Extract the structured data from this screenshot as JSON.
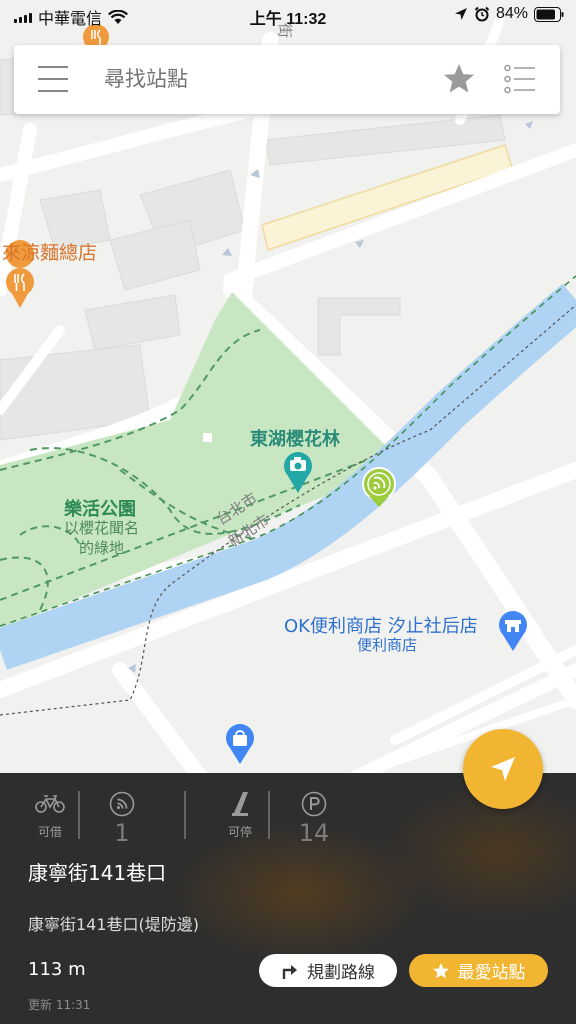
{
  "status_bar": {
    "carrier": "中華電信",
    "time": "上午 11:32",
    "battery": "84%",
    "battery_level": 0.84
  },
  "search": {
    "placeholder": "尋找站點"
  },
  "map": {
    "labels": {
      "restaurant": "來涼麵總店",
      "blossom_forest": "東湖櫻花林",
      "park_name": "樂活公園",
      "park_desc_1": "以櫻花聞名",
      "park_desc_2": "的綠地",
      "taipei": "台北市",
      "new_taipei": "新北市",
      "store_name": "OK便利商店 汐止社后店",
      "store_category": "便利商店",
      "street_partial": "街"
    },
    "colors": {
      "park": "#c9e6c3",
      "river": "#aed3f3",
      "road": "#ffffff",
      "restaurant_pin": "#f09a3e",
      "photo_pin": "#23a7a7",
      "store_pin": "#4285f4",
      "station_pin": "#9ccb3b"
    }
  },
  "station": {
    "rentable_label": "可借",
    "rentable_count": "1",
    "returnable_label": "可停",
    "returnable_count": "14",
    "name": "康寧街141巷口",
    "address": "康寧街141巷口(堤防邊)",
    "distance": "113 m",
    "updated": "更新 11:31",
    "route_button": "規劃路線",
    "favorite_button": "最愛站點"
  },
  "colors": {
    "accent": "#f2b532",
    "panel_bg": "#2e2e2e"
  }
}
